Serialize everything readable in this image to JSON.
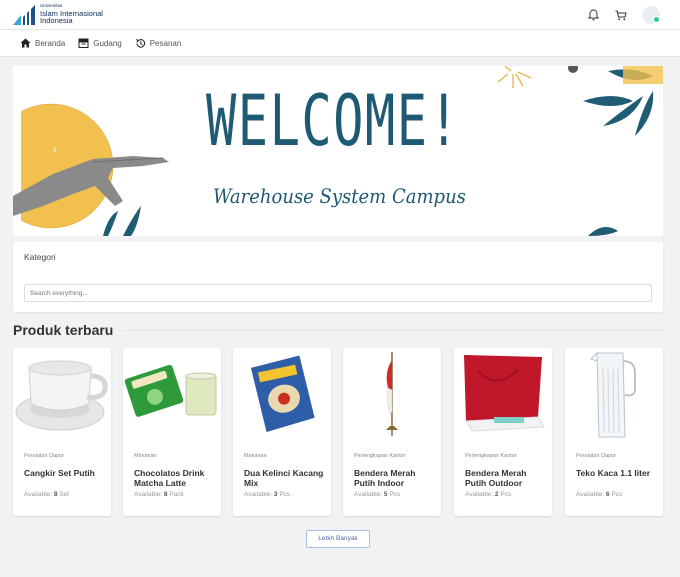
{
  "header": {
    "logo_line1": "Universitas",
    "logo_line2": "Islam Internasional",
    "logo_line3": "Indonesia"
  },
  "nav": {
    "items": [
      {
        "label": "Beranda",
        "icon": "home-icon"
      },
      {
        "label": "Gudang",
        "icon": "warehouse-icon"
      },
      {
        "label": "Pesanan",
        "icon": "history-icon"
      }
    ]
  },
  "banner": {
    "title": "WELCOME!",
    "subtitle": "Warehouse System Campus"
  },
  "kategori": {
    "title": "Kategori",
    "search_placeholder": "Search everything..."
  },
  "section": {
    "title": "Produk terbaru"
  },
  "products": [
    {
      "category": "Peralatan Dapur",
      "name": "Cangkir Set Putih",
      "available_label": "Available:",
      "qty": "8",
      "unit": "Set"
    },
    {
      "category": "Minuman",
      "name": "Chocolatos Drink Matcha Latte",
      "available_label": "Available:",
      "qty": "8",
      "unit": "Pack"
    },
    {
      "category": "Makanan",
      "name": "Dua Kelinci Kacang Mix",
      "available_label": "Available:",
      "qty": "3",
      "unit": "Pcs"
    },
    {
      "category": "Perlengkapan Kantor",
      "name": "Bendera Merah Putih Indoor",
      "available_label": "Available:",
      "qty": "5",
      "unit": "Pcs"
    },
    {
      "category": "Perlengkapan Kantor",
      "name": "Bendera Merah Putih Outdoor",
      "available_label": "Available:",
      "qty": "2",
      "unit": "Pcs"
    },
    {
      "category": "Peralatan Dapur",
      "name": "Teko Kaca 1.1 liter",
      "available_label": "Available:",
      "qty": "6",
      "unit": "Pcs"
    }
  ],
  "more_button": "Lebih Banyak",
  "colors": {
    "brand": "#0b2a5b",
    "accent": "#1e5a73",
    "status_online": "#35c98b"
  }
}
